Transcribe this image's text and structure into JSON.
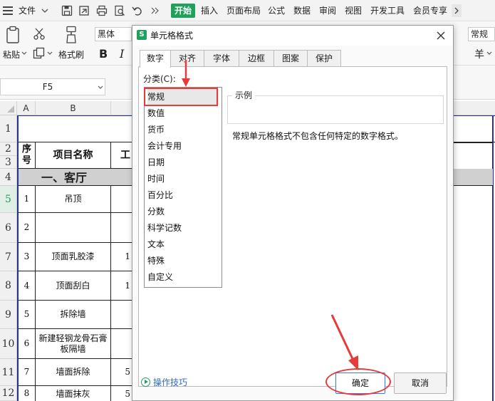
{
  "menubar": {
    "file": "文件",
    "tabs": [
      {
        "label": "开始",
        "active": true
      },
      {
        "label": "插入"
      },
      {
        "label": "页面布局"
      },
      {
        "label": "公式"
      },
      {
        "label": "数据"
      },
      {
        "label": "审阅"
      },
      {
        "label": "视图"
      },
      {
        "label": "开发工具"
      },
      {
        "label": "会员专享"
      }
    ],
    "accent_color": "#1fa05b"
  },
  "ribbon": {
    "paste_label": "粘贴",
    "format_painter_label": "格式刷",
    "font_name": "黑体",
    "bold_label": "B",
    "italic_label": "I",
    "right_box": "常规",
    "currency_symbol": "羊"
  },
  "formula_bar": {
    "cell_ref": "F5"
  },
  "sheet": {
    "columns": [
      "A",
      "B"
    ],
    "rows": [
      {
        "num": "1"
      },
      {
        "num": "2"
      },
      {
        "num": "3"
      },
      {
        "num": "4"
      },
      {
        "num": "5",
        "selected": true
      },
      {
        "num": "6"
      },
      {
        "num": "7"
      },
      {
        "num": "8"
      },
      {
        "num": "9"
      },
      {
        "num": "10"
      },
      {
        "num": "11"
      },
      {
        "num": "12"
      }
    ],
    "header_seq": "序号",
    "header_name": "项目名称",
    "header_partial": "工",
    "section_title": "一、客厅",
    "data_rows": [
      {
        "seq": "1",
        "name": "吊顶",
        "partial": ""
      },
      {
        "seq": "2",
        "name": "",
        "partial": ""
      },
      {
        "seq": "3",
        "name": "顶面乳胶漆",
        "partial": "1"
      },
      {
        "seq": "4",
        "name": "顶面刮白",
        "partial": "1"
      },
      {
        "seq": "5",
        "name": "拆除墙",
        "partial": ""
      },
      {
        "seq": "6",
        "name": "新建轻钢龙骨石膏板隔墙",
        "partial": ""
      },
      {
        "seq": "7",
        "name": "墙面拆除",
        "partial": "5"
      },
      {
        "seq": "8",
        "name": "墙面抹灰",
        "partial": "5"
      }
    ]
  },
  "dialog": {
    "title": "单元格格式",
    "tabs": [
      {
        "label": "数字",
        "active": true
      },
      {
        "label": "对齐"
      },
      {
        "label": "字体"
      },
      {
        "label": "边框"
      },
      {
        "label": "图案"
      },
      {
        "label": "保护"
      }
    ],
    "category_label": "分类(C):",
    "categories": [
      "常规",
      "数值",
      "货币",
      "会计专用",
      "日期",
      "时间",
      "百分比",
      "分数",
      "科学记数",
      "文本",
      "特殊",
      "自定义"
    ],
    "selected_category": "常规",
    "sample_label": "示例",
    "description": "常规单元格格式不包含任何特定的数字格式。",
    "tips_label": "操作技巧",
    "ok_label": "确定",
    "cancel_label": "取消"
  },
  "annotation_color": "#e53b3b"
}
